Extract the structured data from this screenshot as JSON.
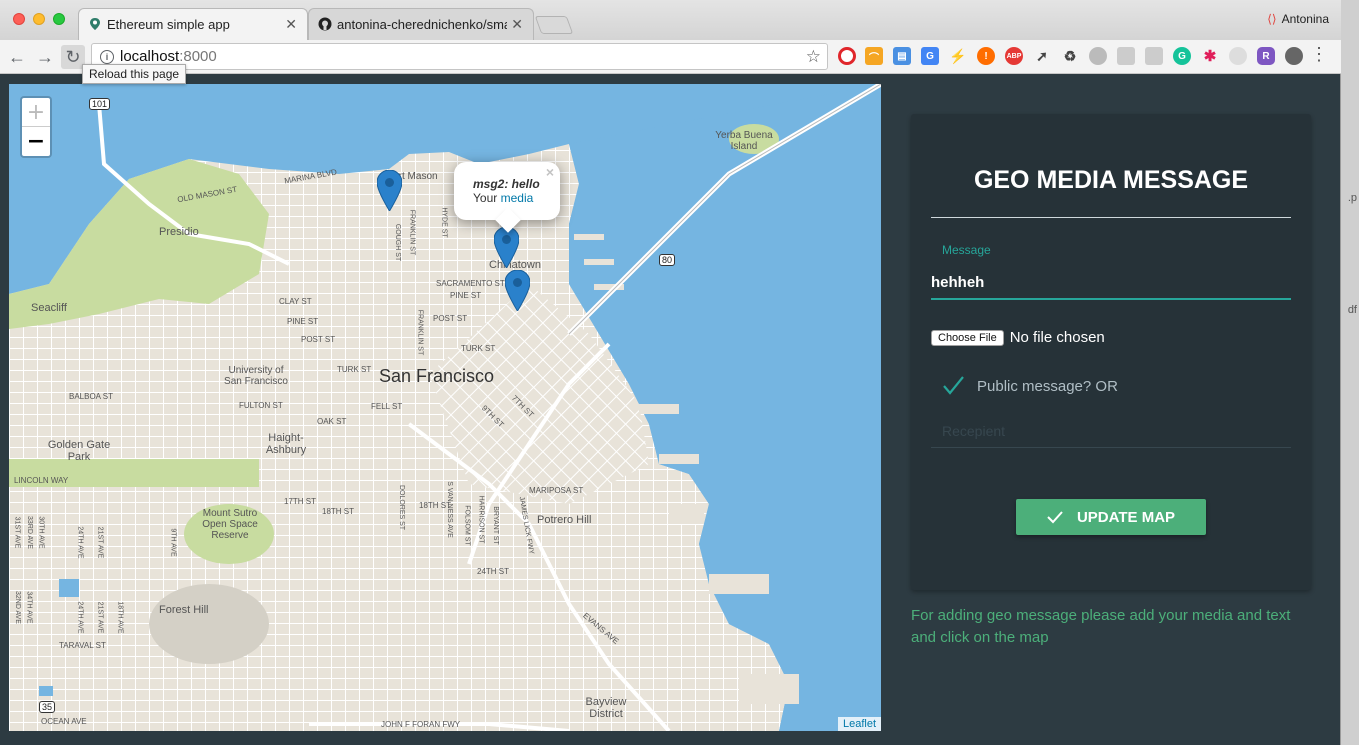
{
  "browser": {
    "tabs": [
      {
        "title": "Ethereum simple app",
        "favicon": "map-pin-icon"
      },
      {
        "title": "antonina-cherednichenko/sma",
        "favicon": "github-icon"
      }
    ],
    "profile_name": "Antonina",
    "url_host": "localhost",
    "url_port": ":8000",
    "reload_tooltip": "Reload this page",
    "extensions": [
      "opera-icon",
      "rss-icon",
      "print-icon",
      "translate-icon",
      "bolt-icon",
      "alert-icon",
      "abp-icon",
      "rocket-icon",
      "recycle-icon",
      "ext-gray-icon",
      "ext-gray-icon",
      "ext-gray-icon",
      "grammarly-icon",
      "slack-icon",
      "ext-gray-icon",
      "r-icon",
      "ext-dark-icon"
    ],
    "abp_label": "ABP",
    "r_label": "R"
  },
  "map": {
    "zoom_in": "+",
    "zoom_out": "−",
    "attribution": "Leaflet",
    "popup": {
      "title": "msg2: hello",
      "body_prefix": "Your ",
      "link": "media",
      "close": "×"
    },
    "city_label": "San Francisco",
    "labels": {
      "presidio": "Presidio",
      "seacliff": "Seacliff",
      "golden_gate_park": "Golden Gate Park",
      "haight_ashbury": "Haight-Ashbury",
      "usf": "University of San Francisco",
      "mount_sutro": "Mount Sutro Open Space Reserve",
      "forest_hill": "Forest Hill",
      "potrero_hill": "Potrero Hill",
      "bayview": "Bayview District",
      "chinatown": "Chinatown",
      "fort_mason": "Fort Mason",
      "yerba_buena": "Yerba Buena Island",
      "hwy101": "101",
      "hwy80": "80",
      "hwy35": "35"
    },
    "streets": {
      "marina": "MARINA BLVD",
      "old_mason": "OLD MASON ST",
      "clay": "CLAY ST",
      "pine": "PINE ST",
      "post": "POST ST",
      "turk": "TURK ST",
      "balboa": "BALBOA ST",
      "fulton": "FULTON ST",
      "oak": "OAK ST",
      "fell": "FELL ST",
      "lincoln": "LINCOLN WAY",
      "sacramento": "SACRAMENTO ST",
      "pine2": "PINE ST",
      "post2": "POST ST",
      "turk2": "TURK ST",
      "ninth": "9TH ST",
      "seventh": "7TH ST",
      "mariposa": "MARIPOSA ST",
      "seventeenth": "17TH ST",
      "eighteenth": "18TH ST",
      "eighteenth2": "18TH ST",
      "twentyfourth": "24TH ST",
      "evans": "EVANS AVE",
      "taraval": "TARAVAL ST",
      "ocean": "OCEAN AVE",
      "jfk": "JOHN F FORAN FWY",
      "gough": "GOUGH ST",
      "franklin": "FRANKLIN ST",
      "franklin2": "FRANKLIN ST",
      "hyde": "HYDE ST",
      "dolores": "DOLORES ST",
      "harrison": "HARRISON ST",
      "folsom": "FOLSOM ST",
      "bryant": "BRYANT ST",
      "james_lick": "JAMES LICK FWY",
      "van_ness": "S VAN NESS AVE",
      "ninth_ave": "9TH AVE",
      "twentyfourth_ave": "24TH AVE",
      "twentyfirst_ave": "21ST AVE",
      "eighteenth_ave": "18TH AVE",
      "twentyfirst_ave2": "21ST AVE",
      "twentyfourth_ave2": "24TH AVE"
    },
    "outer_aves": [
      "31ST AVE",
      "33RD AVE",
      "32ND AVE",
      "34TH AVE",
      "30TH AVE"
    ]
  },
  "form": {
    "title": "GEO MEDIA MESSAGE",
    "message_label": "Message",
    "message_value": "hehheh",
    "file_button": "Choose File",
    "file_status": "No file chosen",
    "public_label": "Public message? OR",
    "recipient_placeholder": "Recepient",
    "update_button": "UPDATE MAP",
    "help_text": "For adding geo message please add your media and text and click on the map"
  },
  "desktop": {
    "edge_labels": [
      ".p",
      "df"
    ]
  },
  "colors": {
    "panel_bg": "#263238",
    "page_bg": "#2d3b42",
    "accent_teal": "#26a69a",
    "accent_green": "#4caf7a",
    "water": "#75b5e1",
    "park": "#c8dca0"
  }
}
